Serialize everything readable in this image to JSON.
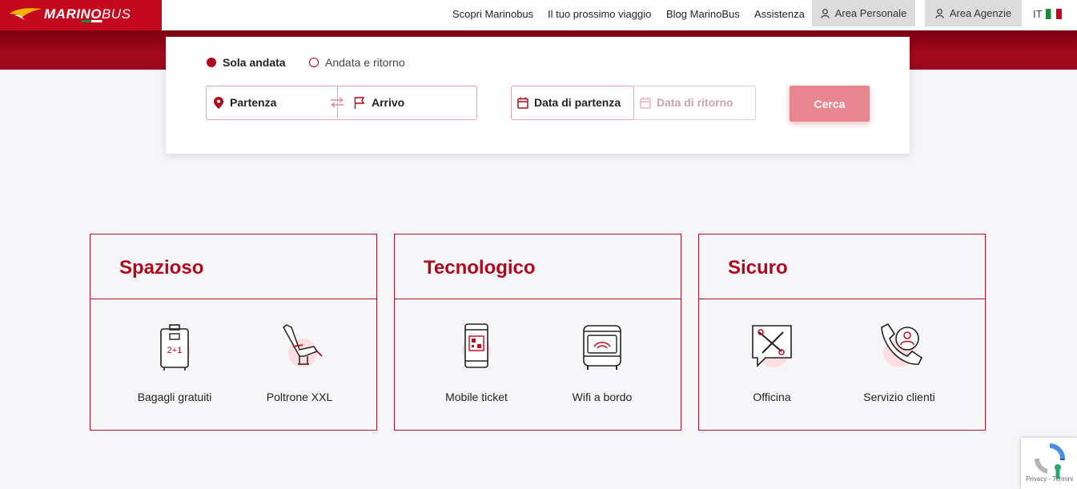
{
  "brand": {
    "name_bold": "MARINO",
    "name_light": "BUS"
  },
  "nav": {
    "links": [
      "Scopri Marinobus",
      "Il tuo prossimo viaggio",
      "Blog MarinoBus",
      "Assistenza"
    ],
    "area_personale": "Area Personale",
    "area_agenzie": "Area Agenzie",
    "language": "IT"
  },
  "search": {
    "trip_one_way": "Sola andata",
    "trip_round": "Andata e ritorno",
    "departure_placeholder": "Partenza",
    "arrival_placeholder": "Arrivo",
    "departure_date": "Data di partenza",
    "return_date": "Data di ritorno",
    "search_button": "Cerca"
  },
  "cards": [
    {
      "title": "Spazioso",
      "features": [
        "Bagagli gratuiti",
        "Poltrone XXL"
      ]
    },
    {
      "title": "Tecnologico",
      "features": [
        "Mobile ticket",
        "Wifi a bordo"
      ]
    },
    {
      "title": "Sicuro",
      "features": [
        "Officina",
        "Servizio clienti"
      ]
    }
  ],
  "icons": {
    "baggage_text": "2+1"
  },
  "recaptcha": {
    "text": "Privacy - Termini"
  },
  "colors": {
    "brand_red": "#c4081e",
    "button": "#e8868f",
    "background": "#f6f5f8"
  }
}
